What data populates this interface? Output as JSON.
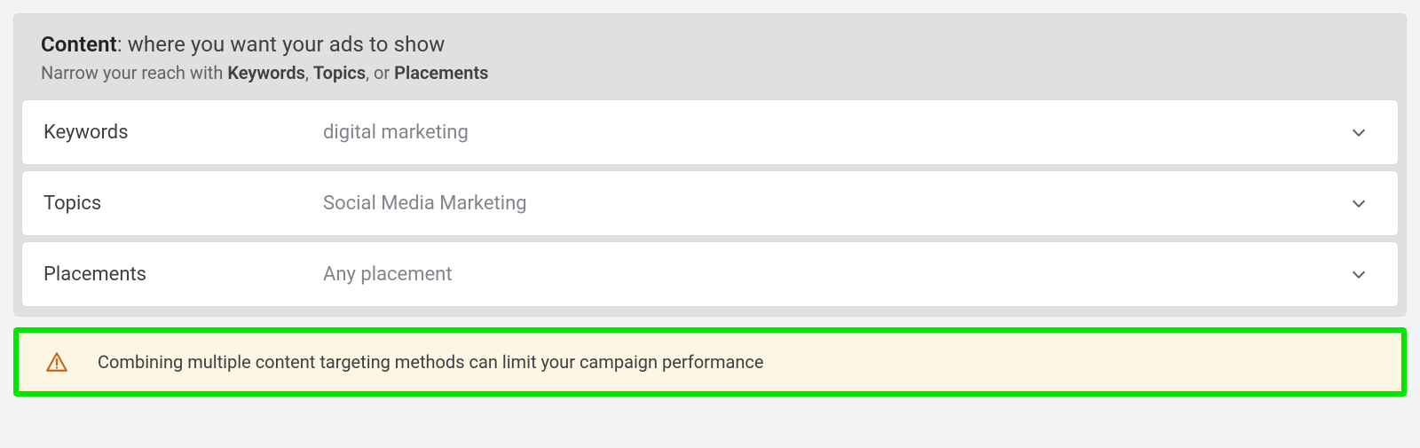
{
  "header": {
    "title_bold": "Content",
    "title_rest": ": where you want your ads to show",
    "sub_pre": "Narrow your reach with ",
    "sub_kw": "Keywords",
    "sub_sep1": ", ",
    "sub_topics": "Topics",
    "sub_sep2": ", or ",
    "sub_placements": "Placements"
  },
  "rows": {
    "keywords": {
      "label": "Keywords",
      "value": "digital marketing"
    },
    "topics": {
      "label": "Topics",
      "value": "Social Media Marketing"
    },
    "placements": {
      "label": "Placements",
      "value": "Any placement"
    }
  },
  "alert": {
    "text": "Combining multiple content targeting methods can limit your campaign performance"
  }
}
